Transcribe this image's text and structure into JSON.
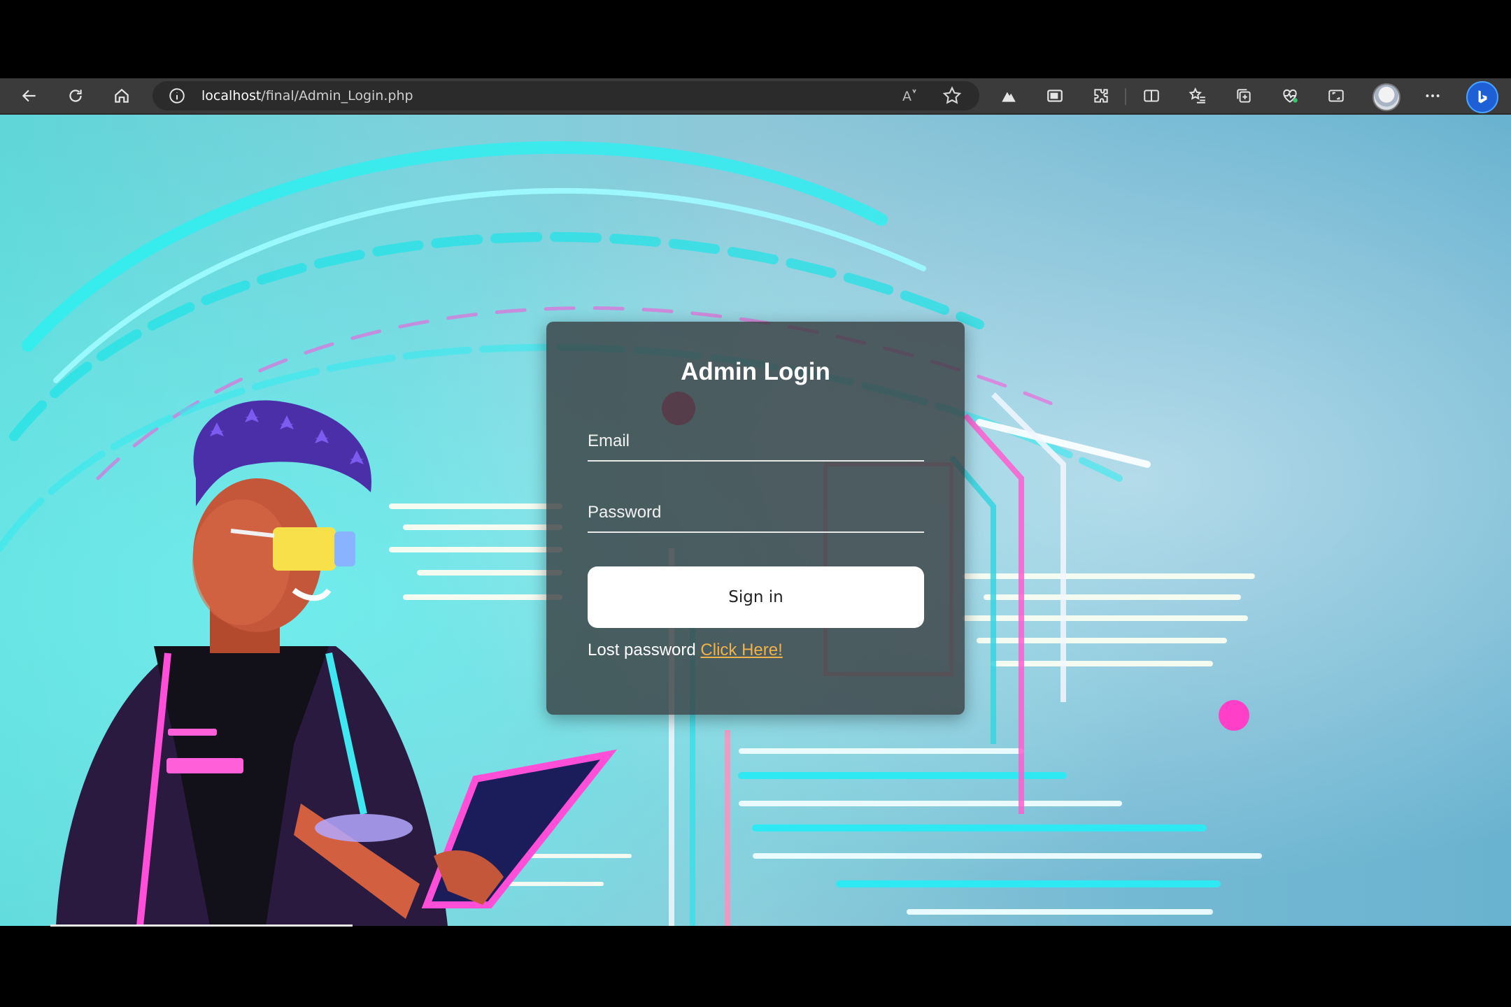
{
  "browser": {
    "url_host": "localhost",
    "url_path": "/final/Admin_Login.php",
    "read_aloud_label": "A",
    "icons": {
      "back": "arrow-left-icon",
      "refresh": "refresh-icon",
      "home": "home-icon",
      "info": "info-icon",
      "read_aloud": "read-aloud-icon",
      "favorite": "star-icon",
      "extension1": "mountain-extension-icon",
      "extension2": "window-extension-icon",
      "extensions": "puzzle-icon",
      "split_screen": "split-screen-icon",
      "favorites": "favorites-list-icon",
      "collections": "collections-icon",
      "performance": "heart-pulse-icon",
      "screenshot": "screenshot-icon",
      "profile": "avatar-icon",
      "more": "more-icon",
      "copilot": "bing-icon"
    }
  },
  "login": {
    "title": "Admin Login",
    "email_placeholder": "Email",
    "password_placeholder": "Password",
    "signin_label": "Sign in",
    "lost_text": "Lost password",
    "lost_link": "Click Here!"
  },
  "colors": {
    "accent_link": "#f2b24a",
    "card_bg": "rgba(55,60,62,0.80)",
    "toolbar_bg": "#3b3b3b"
  }
}
